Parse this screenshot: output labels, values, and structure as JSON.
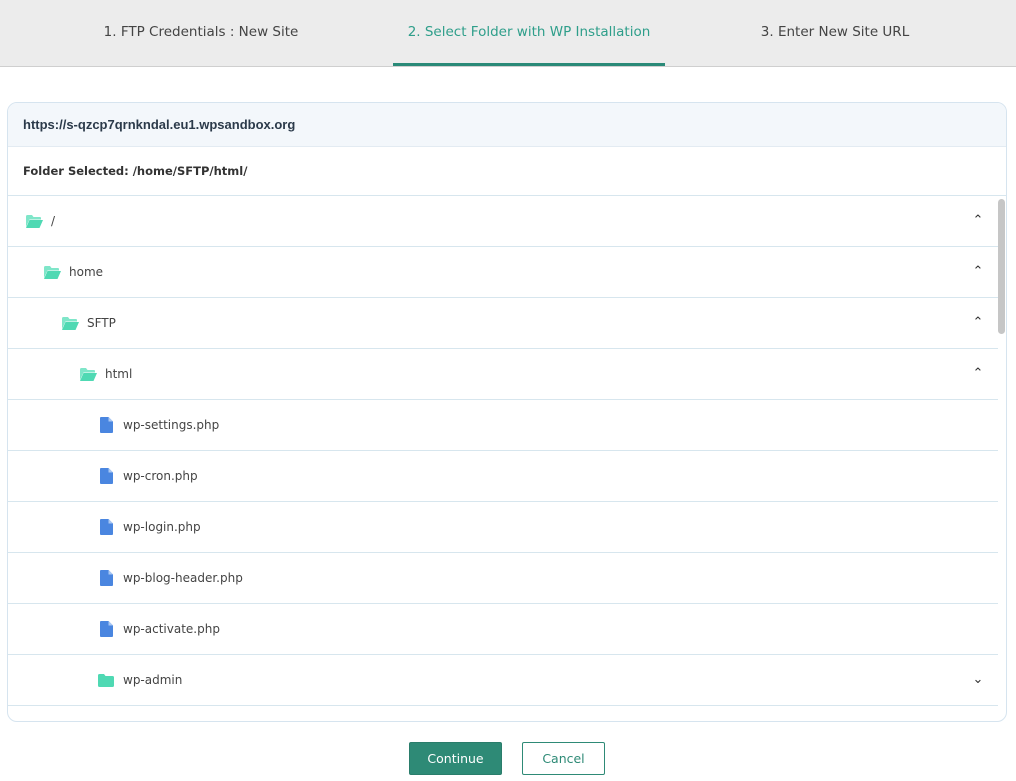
{
  "tabs": [
    {
      "label": "1. FTP Credentials : New Site"
    },
    {
      "label": "2. Select Folder with WP Installation"
    },
    {
      "label": "3. Enter New Site URL"
    }
  ],
  "panel": {
    "site_url": "https://s-qzcp7qrnkndal.eu1.wpsandbox.org",
    "folder_selected": "Folder Selected: /home/SFTP/html/"
  },
  "tree": [
    {
      "label": "/",
      "type": "folder-open",
      "expanded": true
    },
    {
      "label": "home",
      "type": "folder-open",
      "expanded": true
    },
    {
      "label": "SFTP",
      "type": "folder-open",
      "expanded": true
    },
    {
      "label": "html",
      "type": "folder-open",
      "expanded": true
    },
    {
      "label": "wp-settings.php",
      "type": "file"
    },
    {
      "label": "wp-cron.php",
      "type": "file"
    },
    {
      "label": "wp-login.php",
      "type": "file"
    },
    {
      "label": "wp-blog-header.php",
      "type": "file"
    },
    {
      "label": "wp-activate.php",
      "type": "file"
    },
    {
      "label": "wp-admin",
      "type": "folder-closed",
      "expanded": false
    }
  ],
  "buttons": {
    "continue": "Continue",
    "cancel": "Cancel"
  },
  "colors": {
    "accent": "#2e8a76",
    "folder": "#4fd9b3",
    "file": "#4a86e0"
  }
}
